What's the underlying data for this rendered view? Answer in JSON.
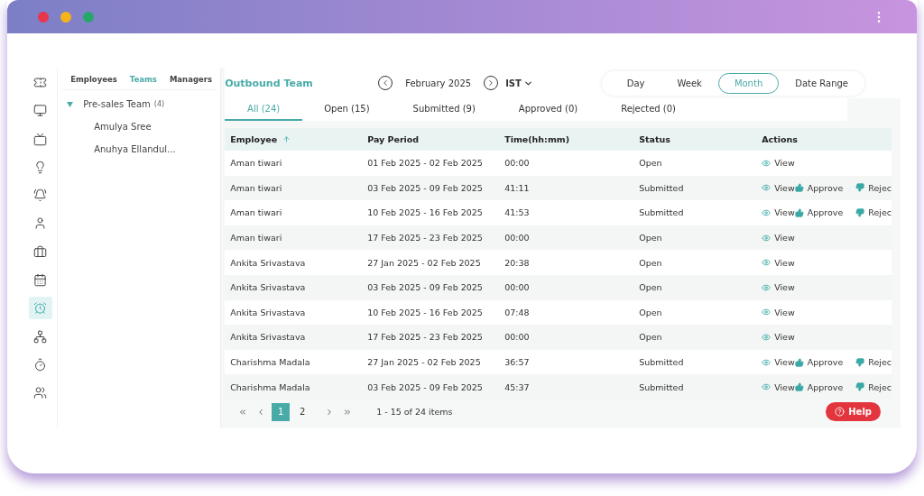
{
  "rail": [
    {
      "selected": false
    },
    {
      "selected": false
    },
    {
      "selected": false
    },
    {
      "selected": false
    },
    {
      "selected": false
    },
    {
      "selected": false
    },
    {
      "selected": false
    },
    {
      "selected": false
    },
    {
      "selected": true
    },
    {
      "selected": false
    },
    {
      "selected": false
    },
    {
      "selected": false
    }
  ],
  "panel": {
    "tabs": [
      {
        "label": "Employees",
        "selected": false
      },
      {
        "label": "Teams",
        "selected": true
      },
      {
        "label": "Managers",
        "selected": false
      }
    ],
    "tree": [
      {
        "label": "Pre-sales Team",
        "count": "(4)",
        "expanded": true,
        "children": [
          {
            "label": "Amulya Sree"
          },
          {
            "label": "Anuhya Ellandul..."
          }
        ]
      }
    ]
  },
  "header": {
    "title": "Outbound Team",
    "period": "February 2025",
    "timezone": "IST",
    "ranges": [
      {
        "label": "Day",
        "selected": false
      },
      {
        "label": "Week",
        "selected": false
      },
      {
        "label": "Month",
        "selected": true
      },
      {
        "label": "Date Range",
        "selected": false
      }
    ]
  },
  "status_tabs": [
    {
      "label": "All (24)",
      "selected": true
    },
    {
      "label": "Open (15)",
      "selected": false
    },
    {
      "label": "Submitted (9)",
      "selected": false
    },
    {
      "label": "Approved (0)",
      "selected": false
    },
    {
      "label": "Rejected (0)",
      "selected": false
    }
  ],
  "table": {
    "columns": [
      {
        "label": "Employee",
        "sorted": true
      },
      {
        "label": "Pay Period",
        "sorted": false
      },
      {
        "label": "Time(hh:mm)",
        "sorted": false
      },
      {
        "label": "Status",
        "sorted": false
      },
      {
        "label": "Actions",
        "sorted": false
      }
    ],
    "rows": [
      {
        "employee": "Aman tiwari",
        "pay_period": "01 Feb 2025 - 02 Feb 2025",
        "time": "00:00",
        "status": "Open",
        "actions": [
          "View"
        ]
      },
      {
        "employee": "Aman tiwari",
        "pay_period": "03 Feb 2025 - 09 Feb 2025",
        "time": "41:11",
        "status": "Submitted",
        "actions": [
          "View",
          "Approve",
          "Rejec"
        ]
      },
      {
        "employee": "Aman tiwari",
        "pay_period": "10 Feb 2025 - 16 Feb 2025",
        "time": "41:53",
        "status": "Submitted",
        "actions": [
          "View",
          "Approve",
          "Rejec"
        ]
      },
      {
        "employee": "Aman tiwari",
        "pay_period": "17 Feb 2025 - 23 Feb 2025",
        "time": "00:00",
        "status": "Open",
        "actions": [
          "View"
        ]
      },
      {
        "employee": "Ankita Srivastava",
        "pay_period": "27 Jan 2025 - 02 Feb 2025",
        "time": "20:38",
        "status": "Open",
        "actions": [
          "View"
        ]
      },
      {
        "employee": "Ankita Srivastava",
        "pay_period": "03 Feb 2025 - 09 Feb 2025",
        "time": "00:00",
        "status": "Open",
        "actions": [
          "View"
        ]
      },
      {
        "employee": "Ankita Srivastava",
        "pay_period": "10 Feb 2025 - 16 Feb 2025",
        "time": "07:48",
        "status": "Open",
        "actions": [
          "View"
        ]
      },
      {
        "employee": "Ankita Srivastava",
        "pay_period": "17 Feb 2025 - 23 Feb 2025",
        "time": "00:00",
        "status": "Open",
        "actions": [
          "View"
        ]
      },
      {
        "employee": "Charishma Madala",
        "pay_period": "27 Jan 2025 - 02 Feb 2025",
        "time": "36:57",
        "status": "Submitted",
        "actions": [
          "View",
          "Approve",
          "Rejec"
        ]
      },
      {
        "employee": "Charishma Madala",
        "pay_period": "03 Feb 2025 - 09 Feb 2025",
        "time": "45:37",
        "status": "Submitted",
        "actions": [
          "View",
          "Approve",
          "Rejec"
        ]
      }
    ]
  },
  "pager": {
    "pages": [
      {
        "label": "1",
        "selected": true
      },
      {
        "label": "2",
        "selected": false
      }
    ],
    "summary": "1 - 15 of 24 items"
  },
  "help": {
    "label": "Help"
  }
}
